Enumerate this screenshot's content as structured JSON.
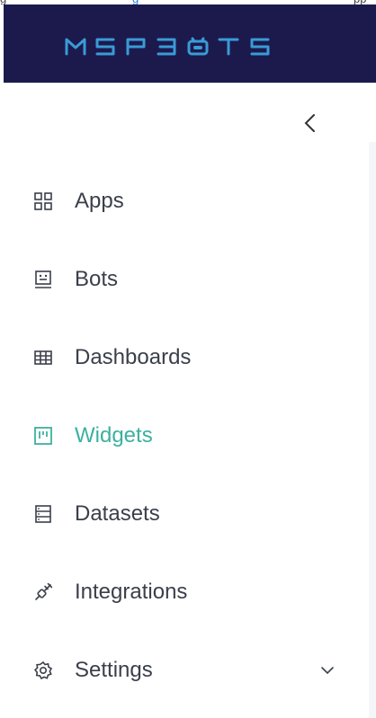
{
  "top_strip": {
    "text_left": "g",
    "text_link": "g",
    "text_right": "pp"
  },
  "header": {
    "brand": "MSPBOTS",
    "bg_color": "#1c1a4d",
    "logo_color": "#3a9bd6"
  },
  "sidebar": {
    "collapse_icon": "chevron-left-icon",
    "accent_color": "#3cb0a0",
    "items": [
      {
        "label": "Apps",
        "icon": "grid-icon",
        "active": false
      },
      {
        "label": "Bots",
        "icon": "bot-icon",
        "active": false
      },
      {
        "label": "Dashboards",
        "icon": "table-icon",
        "active": false
      },
      {
        "label": "Widgets",
        "icon": "widget-icon",
        "active": true
      },
      {
        "label": "Datasets",
        "icon": "dataset-icon",
        "active": false
      },
      {
        "label": "Integrations",
        "icon": "plug-icon",
        "active": false
      },
      {
        "label": "Settings",
        "icon": "gear-icon",
        "active": false,
        "expand_icon": "chevron-down-icon"
      }
    ]
  }
}
